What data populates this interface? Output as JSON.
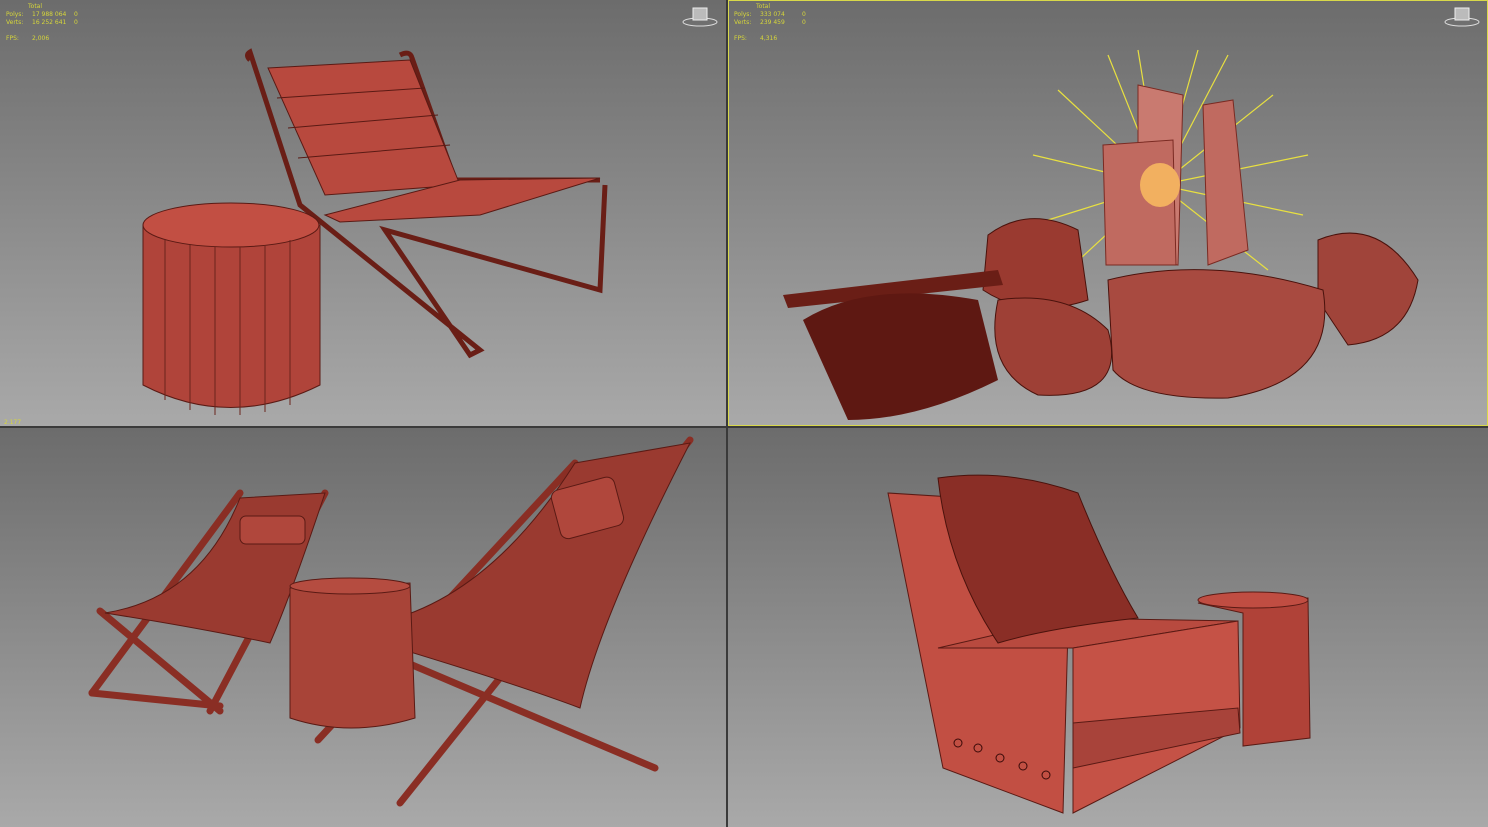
{
  "viewports": [
    {
      "name": "top-left",
      "stats": {
        "title": "Total",
        "polys_label": "Polys:",
        "polys": "17 988 064",
        "polys_sel": "0",
        "verts_label": "Verts:",
        "verts": "16 252 641",
        "verts_sel": "0",
        "fps_label": "FPS:",
        "fps": "2,006"
      },
      "axis_readout": "2.177"
    },
    {
      "name": "top-right",
      "stats": {
        "title": "Total",
        "polys_label": "Polys:",
        "polys": "333 074",
        "polys_sel": "0",
        "verts_label": "Verts:",
        "verts": "239 459",
        "verts_sel": "0",
        "fps_label": "FPS:",
        "fps": "4,316"
      }
    },
    {
      "name": "bottom-left"
    },
    {
      "name": "bottom-right"
    }
  ],
  "colors": {
    "mesh": "#b8493e",
    "wire": "#5a1a14",
    "stats": "#d6d63a",
    "active_border": "#d8d84a",
    "light": "#f0e040"
  }
}
